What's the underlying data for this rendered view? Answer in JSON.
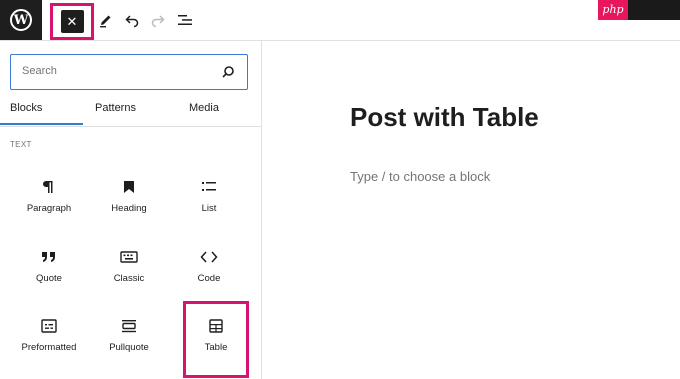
{
  "toolbar": {
    "logo_letter": "W",
    "close_glyph": "✕",
    "tools": [
      "pencil-icon",
      "undo-icon",
      "redo-icon",
      "document-overview-icon"
    ]
  },
  "badge": {
    "text": "php"
  },
  "inserter": {
    "search_placeholder": "Search",
    "tabs": [
      "Blocks",
      "Patterns",
      "Media"
    ],
    "section_title": "TEXT",
    "blocks": [
      {
        "label": "Paragraph",
        "icon": "paragraph-icon"
      },
      {
        "label": "Heading",
        "icon": "bookmark-icon"
      },
      {
        "label": "List",
        "icon": "list-icon"
      },
      {
        "label": "Quote",
        "icon": "quote-icon"
      },
      {
        "label": "Classic",
        "icon": "keyboard-icon"
      },
      {
        "label": "Code",
        "icon": "code-icon"
      },
      {
        "label": "Preformatted",
        "icon": "preformatted-icon"
      },
      {
        "label": "Pullquote",
        "icon": "pullquote-icon"
      },
      {
        "label": "Table",
        "icon": "table-icon"
      }
    ]
  },
  "editor": {
    "title": "Post with Table",
    "placeholder": "Type / to choose a block"
  },
  "colors": {
    "accent": "#d8136f",
    "focus": "#3a7bd5",
    "dark": "#1e1e1e"
  }
}
